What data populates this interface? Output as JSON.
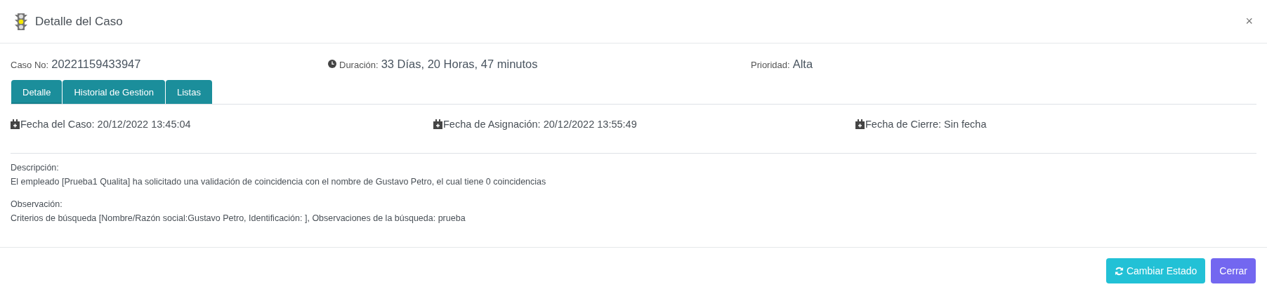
{
  "modal": {
    "title": "Detalle del Caso",
    "close": "×"
  },
  "info": [
    {
      "kind": "plain",
      "label": "Caso No:",
      "value": "20221159433947"
    },
    {
      "kind": "clock",
      "label": "Duración:",
      "value": "33 Días, 20 Horas, 47 minutos"
    },
    {
      "kind": "plain",
      "label": "Prioridad:",
      "value": "Alta"
    }
  ],
  "tabs": [
    {
      "label": "Detalle",
      "selected": true
    },
    {
      "label": "Historial de Gestion",
      "selected": false
    },
    {
      "label": "Listas",
      "selected": false
    }
  ],
  "dates": [
    {
      "label": "Fecha del Caso: 20/12/2022 13:45:04"
    },
    {
      "label": "Fecha de Asignación: 20/12/2022 13:55:49"
    },
    {
      "label": "Fecha de Cierre: Sin fecha"
    }
  ],
  "sections": [
    {
      "label": "Descripción:",
      "text": "El empleado [Prueba1 Qualita] ha solicitado una validación de coincidencia con el nombre de Gustavo Petro, el cual tiene 0 coincidencias"
    },
    {
      "label": "Observación:",
      "text": "Criterios de búsqueda [Nombre/Razón social:Gustavo Petro, Identificación: ], Observaciones de la búsqueda: prueba"
    }
  ],
  "buttons": [
    {
      "kind": "change",
      "label": "Cambiar Estado"
    },
    {
      "kind": "close",
      "label": "Cerrar"
    }
  ]
}
